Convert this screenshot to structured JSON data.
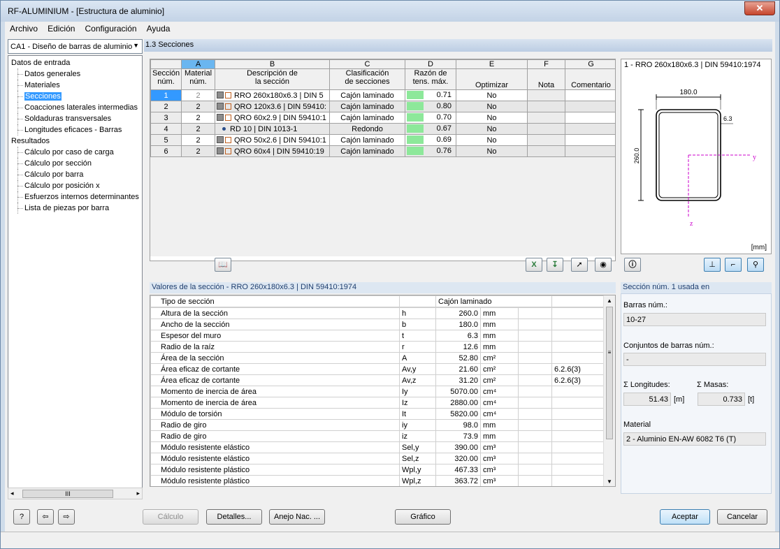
{
  "window": {
    "title": "RF-ALUMINIUM - [Estructura de aluminio]",
    "close_glyph": "✕"
  },
  "menu": [
    "Archivo",
    "Edición",
    "Configuración",
    "Ayuda"
  ],
  "case_selector": {
    "value": "CA1 - Diseño de barras de aluminio"
  },
  "tree": {
    "group1": "Datos de entrada",
    "input_items": [
      "Datos generales",
      "Materiales",
      "Secciones",
      "Coacciones laterales intermedias",
      "Soldaduras transversales",
      "Longitudes eficaces - Barras"
    ],
    "group2": "Resultados",
    "result_items": [
      "Cálculo por caso de carga",
      "Cálculo por sección",
      "Cálculo por barra",
      "Cálculo por posición x",
      "Esfuerzos internos determinantes",
      "Lista de piezas por barra"
    ],
    "scroll_thumb": "III"
  },
  "panel_title": "1.3 Secciones",
  "grid": {
    "letters": [
      "A",
      "B",
      "C",
      "D",
      "E",
      "F",
      "G"
    ],
    "headers": {
      "sec_1": "Sección",
      "sec_2": "núm.",
      "mat_1": "Material",
      "mat_2": "núm.",
      "desc_1": "Descripción de",
      "desc_2": "la sección",
      "clas_1": "Clasificación",
      "clas_2": "de secciones",
      "ratio_1": "Razón de",
      "ratio_2": "tens. máx.",
      "opt": "Optimizar",
      "note": "Nota",
      "comment": "Comentario"
    },
    "rows": [
      {
        "n": "1",
        "mat": "2",
        "desc": "RRO 260x180x6.3 | DIN 5",
        "clas": "Cajón laminado",
        "ratio": "0.71",
        "opt": "No"
      },
      {
        "n": "2",
        "mat": "2",
        "desc": "QRO 120x3.6 | DIN 59410:",
        "clas": "Cajón laminado",
        "ratio": "0.80",
        "opt": "No"
      },
      {
        "n": "3",
        "mat": "2",
        "desc": "QRO 60x2.9 | DIN 59410:1",
        "clas": "Cajón laminado",
        "ratio": "0.70",
        "opt": "No"
      },
      {
        "n": "4",
        "mat": "2",
        "desc": "RD 10 | DIN 1013-1",
        "clas": "Redondo",
        "ratio": "0.67",
        "opt": "No"
      },
      {
        "n": "5",
        "mat": "2",
        "desc": "QRO 50x2.6 | DIN 59410:1",
        "clas": "Cajón laminado",
        "ratio": "0.69",
        "opt": "No"
      },
      {
        "n": "6",
        "mat": "2",
        "desc": "QRO 60x4 | DIN 59410:19",
        "clas": "Cajón laminado",
        "ratio": "0.76",
        "opt": "No"
      }
    ]
  },
  "preview": {
    "caption": "1 - RRO 260x180x6.3 | DIN 59410:1974",
    "dim_w": "180.0",
    "dim_h": "260.0",
    "dim_t": "6.3",
    "axis_y": "y",
    "axis_z": "z",
    "unit": "[mm]"
  },
  "props": {
    "title": "Valores de la sección  -  RRO 260x180x6.3 | DIN 59410:1974",
    "head_type": "Tipo de sección",
    "head_value": "Cajón laminado",
    "rows": [
      {
        "name": "Altura de la sección",
        "sym": "h",
        "val": "260.0",
        "unit": "mm",
        "ref": ""
      },
      {
        "name": "Ancho de la sección",
        "sym": "b",
        "val": "180.0",
        "unit": "mm",
        "ref": ""
      },
      {
        "name": "Espesor del muro",
        "sym": "t",
        "val": "6.3",
        "unit": "mm",
        "ref": ""
      },
      {
        "name": "Radio de la raíz",
        "sym": "r",
        "val": "12.6",
        "unit": "mm",
        "ref": ""
      },
      {
        "name": "Área de la sección",
        "sym": "A",
        "val": "52.80",
        "unit": "cm²",
        "ref": ""
      },
      {
        "name": "Área eficaz de cortante",
        "sym": "Av,y",
        "val": "21.60",
        "unit": "cm²",
        "ref": "6.2.6(3)"
      },
      {
        "name": "Área eficaz de cortante",
        "sym": "Av,z",
        "val": "31.20",
        "unit": "cm²",
        "ref": "6.2.6(3)"
      },
      {
        "name": "Momento de inercia de área",
        "sym": "Iy",
        "val": "5070.00",
        "unit": "cm⁴",
        "ref": ""
      },
      {
        "name": "Momento de inercia de área",
        "sym": "Iz",
        "val": "2880.00",
        "unit": "cm⁴",
        "ref": ""
      },
      {
        "name": "Módulo de torsión",
        "sym": "It",
        "val": "5820.00",
        "unit": "cm⁴",
        "ref": ""
      },
      {
        "name": "Radio de giro",
        "sym": "iy",
        "val": "98.0",
        "unit": "mm",
        "ref": ""
      },
      {
        "name": "Radio de giro",
        "sym": "iz",
        "val": "73.9",
        "unit": "mm",
        "ref": ""
      },
      {
        "name": "Módulo resistente elástico",
        "sym": "Sel,y",
        "val": "390.00",
        "unit": "cm³",
        "ref": ""
      },
      {
        "name": "Módulo resistente elástico",
        "sym": "Sel,z",
        "val": "320.00",
        "unit": "cm³",
        "ref": ""
      },
      {
        "name": "Módulo resistente plástico",
        "sym": "Wpl,y",
        "val": "467.33",
        "unit": "cm³",
        "ref": ""
      },
      {
        "name": "Módulo resistente plástico",
        "sym": "Wpl,z",
        "val": "363.72",
        "unit": "cm³",
        "ref": ""
      }
    ]
  },
  "usage": {
    "title": "Sección núm. 1 usada en",
    "bars_label": "Barras núm.:",
    "bars_value": "10-27",
    "sets_label": "Conjuntos de barras núm.:",
    "sets_value": "-",
    "len_label": "Σ Longitudes:",
    "len_value": "51.43",
    "len_unit": "[m]",
    "mass_label": "Σ Masas:",
    "mass_value": "0.733",
    "mass_unit": "[t]",
    "mat_label": "Material",
    "mat_value": "2 - Aluminio EN-AW 6082 T6 (T)"
  },
  "buttons": {
    "calc": "Cálculo",
    "details": "Detalles...",
    "annex": "Anejo Nac. ...",
    "graphic": "Gráfico",
    "ok": "Aceptar",
    "cancel": "Cancelar"
  },
  "colors": {
    "selected": "#3399ff",
    "ratio_bar": "#8de89a",
    "header_blue": "#1e3e6e"
  }
}
